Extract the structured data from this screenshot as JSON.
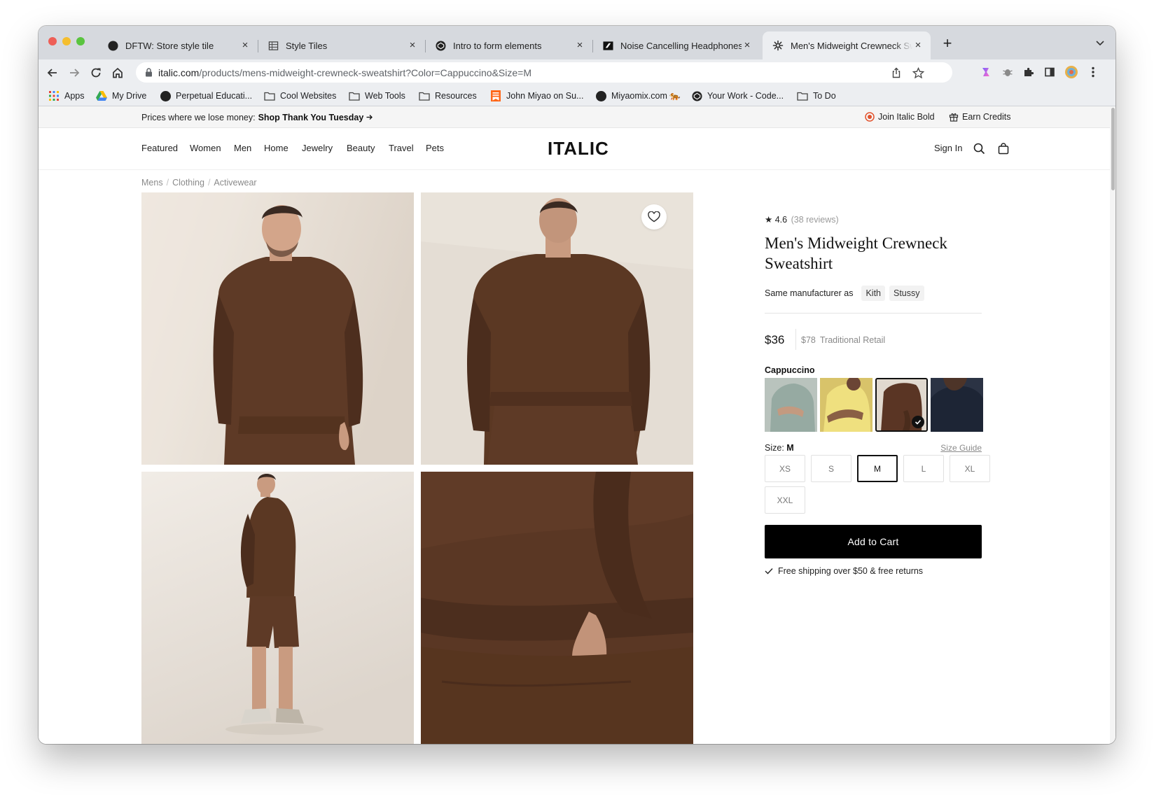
{
  "browser": {
    "tabs": [
      {
        "title": "DFTW: Store style tile",
        "favicon": "github-icon"
      },
      {
        "title": "Style Tiles",
        "favicon": "grid-page-icon"
      },
      {
        "title": "Intro to form elements",
        "favicon": "codepen-icon"
      },
      {
        "title": "Noise Cancelling Headphones",
        "favicon": "brand-icon"
      },
      {
        "title": "Men's Midweight Crewneck Sweatshirt",
        "favicon": "italic-icon"
      }
    ],
    "url_host": "italic.com",
    "url_path": "/products/mens-midweight-crewneck-sweatshirt?Color=Cappuccino&Size=M",
    "bookmarks": [
      {
        "label": "Apps",
        "icon": "apps-grid-icon"
      },
      {
        "label": "My Drive",
        "icon": "google-drive-icon"
      },
      {
        "label": "Perpetual Educati...",
        "icon": "circle-icon"
      },
      {
        "label": "Cool Websites",
        "icon": "folder-icon"
      },
      {
        "label": "Web Tools",
        "icon": "folder-icon"
      },
      {
        "label": "Resources",
        "icon": "folder-icon"
      },
      {
        "label": "John Miyao on Su...",
        "icon": "bookmark-icon"
      },
      {
        "label": "Miyaomix.com 🐅",
        "icon": "circle-icon"
      },
      {
        "label": "Your Work - Code...",
        "icon": "codepen-icon"
      },
      {
        "label": "To Do",
        "icon": "folder-icon"
      }
    ]
  },
  "promo": {
    "text": "Prices where we lose money:",
    "link": "Shop Thank You Tuesday",
    "join": "Join Italic Bold",
    "credits": "Earn Credits"
  },
  "nav": {
    "links": [
      "Featured",
      "Women",
      "Men",
      "Home",
      "Jewelry",
      "Beauty",
      "Travel",
      "Pets"
    ],
    "logo": "ITALIC",
    "sign_in": "Sign In"
  },
  "breadcrumbs": [
    "Mens",
    "Clothing",
    "Activewear"
  ],
  "product": {
    "rating": "4.6",
    "reviews": "(38 reviews)",
    "title": "Men's Midweight Crewneck Sweatshirt",
    "same_manufacturer_label": "Same manufacturer as",
    "manufacturers": [
      "Kith",
      "Stussy"
    ],
    "price": "$36",
    "retail_price": "$78",
    "retail_label": "Traditional Retail",
    "color_label": "Cappuccino",
    "color_swatches": [
      {
        "color": "#9fb2ab",
        "selected": false
      },
      {
        "color": "#efe07f",
        "selected": false
      },
      {
        "color": "#5a3524",
        "selected": true
      },
      {
        "color": "#1d2535",
        "selected": false
      }
    ],
    "size_label": "Size:",
    "size_value": "M",
    "size_guide": "Size Guide",
    "sizes": [
      {
        "label": "XS",
        "selected": false
      },
      {
        "label": "S",
        "selected": false
      },
      {
        "label": "M",
        "selected": true
      },
      {
        "label": "L",
        "selected": false
      },
      {
        "label": "XL",
        "selected": false
      },
      {
        "label": "XXL",
        "selected": false
      }
    ],
    "add_to_cart": "Add to Cart",
    "shipping": "Free shipping over $50 & free returns"
  },
  "colors": {
    "accent": "#000000",
    "sweatshirt_brown": "#5e3a26",
    "photo_background": "#e8e2da"
  }
}
